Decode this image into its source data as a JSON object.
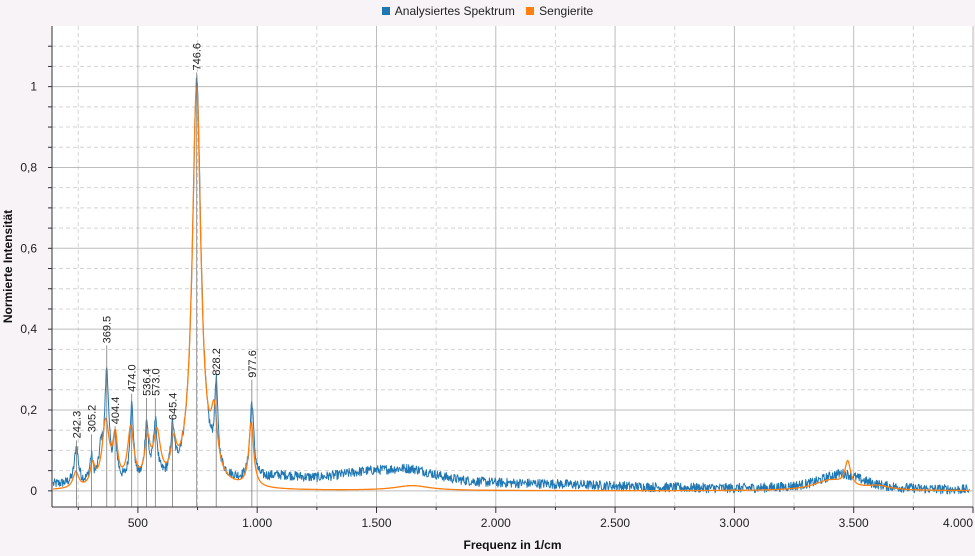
{
  "chart_data": {
    "type": "line",
    "xlabel": "Frequenz in 1/cm",
    "ylabel": "Normierte Intensität",
    "xlim": [
      140,
      4000
    ],
    "ylim": [
      -0.04,
      1.15
    ],
    "xticks": [
      500,
      1000,
      1500,
      2000,
      2500,
      3000,
      3500,
      4000
    ],
    "xtick_labels": [
      "500",
      "1.000",
      "1.500",
      "2.000",
      "2.500",
      "3.000",
      "3.500",
      "4.000"
    ],
    "yticks": [
      0,
      0.2,
      0.4,
      0.6,
      0.8,
      1
    ],
    "ytick_labels": [
      "0",
      "0,2",
      "0,4",
      "0,6",
      "0,8",
      "1"
    ],
    "grid": true,
    "legend_position": "top-center",
    "series": [
      {
        "name": "Analysiertes Spektrum",
        "color": "#1f77b4",
        "peaks": [
          {
            "x": 150,
            "y": 0.012,
            "w": 400
          },
          {
            "x": 242.3,
            "y": 0.09,
            "w": 10
          },
          {
            "x": 305.2,
            "y": 0.06,
            "w": 8
          },
          {
            "x": 345,
            "y": 0.07,
            "w": 10
          },
          {
            "x": 369.5,
            "y": 0.27,
            "w": 10
          },
          {
            "x": 404.4,
            "y": 0.1,
            "w": 10
          },
          {
            "x": 474.0,
            "y": 0.19,
            "w": 9
          },
          {
            "x": 536.4,
            "y": 0.14,
            "w": 9
          },
          {
            "x": 573.0,
            "y": 0.14,
            "w": 10
          },
          {
            "x": 645.4,
            "y": 0.11,
            "w": 9
          },
          {
            "x": 746.6,
            "y": 1.0,
            "w": 22
          },
          {
            "x": 828.2,
            "y": 0.2,
            "w": 8
          },
          {
            "x": 977.6,
            "y": 0.19,
            "w": 10
          },
          {
            "x": 1100,
            "y": 0.02,
            "w": 120
          },
          {
            "x": 1450,
            "y": 0.03,
            "w": 220
          },
          {
            "x": 1650,
            "y": 0.03,
            "w": 150
          },
          {
            "x": 2200,
            "y": 0.012,
            "w": 500
          },
          {
            "x": 3450,
            "y": 0.04,
            "w": 110
          }
        ],
        "noise": 0.012
      },
      {
        "name": "Sengierite",
        "color": "#ff7f0e",
        "peaks": [
          {
            "x": 240,
            "y": 0.04,
            "w": 14
          },
          {
            "x": 310,
            "y": 0.05,
            "w": 12
          },
          {
            "x": 365,
            "y": 0.16,
            "w": 18
          },
          {
            "x": 405,
            "y": 0.11,
            "w": 12
          },
          {
            "x": 470,
            "y": 0.14,
            "w": 16
          },
          {
            "x": 540,
            "y": 0.1,
            "w": 14
          },
          {
            "x": 580,
            "y": 0.12,
            "w": 18
          },
          {
            "x": 650,
            "y": 0.08,
            "w": 14
          },
          {
            "x": 746,
            "y": 0.99,
            "w": 22
          },
          {
            "x": 820,
            "y": 0.14,
            "w": 16
          },
          {
            "x": 975,
            "y": 0.16,
            "w": 12
          },
          {
            "x": 1650,
            "y": 0.012,
            "w": 90
          },
          {
            "x": 3400,
            "y": 0.025,
            "w": 80
          },
          {
            "x": 3475,
            "y": 0.06,
            "w": 14
          },
          {
            "x": 3600,
            "y": 0.01,
            "w": 60
          }
        ],
        "noise": 0
      }
    ],
    "annotations": [
      {
        "x": 242.3,
        "y": 0.12,
        "label": "242.3"
      },
      {
        "x": 305.2,
        "y": 0.135,
        "label": "305.2"
      },
      {
        "x": 369.5,
        "y": 0.355,
        "label": "369.5"
      },
      {
        "x": 404.4,
        "y": 0.155,
        "label": "404.4"
      },
      {
        "x": 474.0,
        "y": 0.235,
        "label": "474.0"
      },
      {
        "x": 536.4,
        "y": 0.225,
        "label": "536.4"
      },
      {
        "x": 573.0,
        "y": 0.225,
        "label": "573.0"
      },
      {
        "x": 645.4,
        "y": 0.165,
        "label": "645.4"
      },
      {
        "x": 746.6,
        "y": 1.03,
        "label": "746.6"
      },
      {
        "x": 828.2,
        "y": 0.275,
        "label": "828.2"
      },
      {
        "x": 977.6,
        "y": 0.27,
        "label": "977.6"
      }
    ]
  }
}
